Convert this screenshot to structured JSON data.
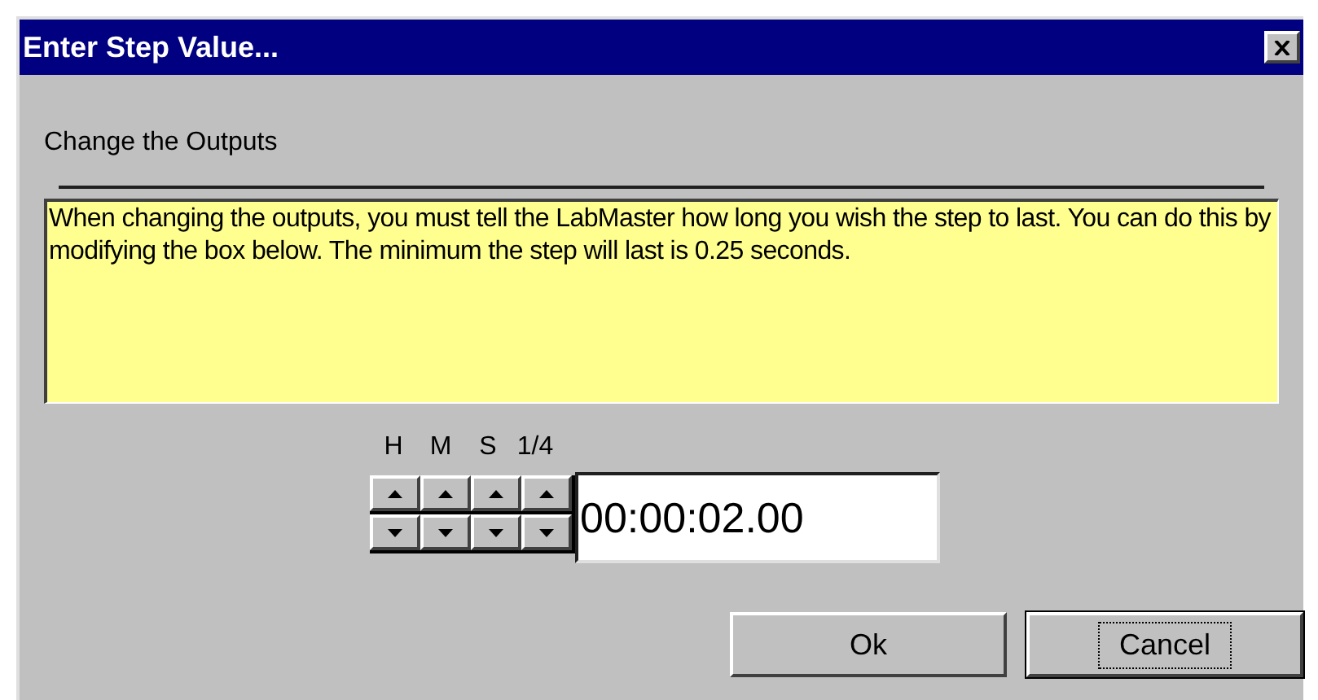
{
  "window": {
    "title": "Enter Step Value..."
  },
  "section_label": "Change the Outputs",
  "info_text": "When changing the outputs, you must tell the LabMaster how long you wish the step to last.  You can do this by modifying the box below.  The minimum the step will last is 0.25 seconds.",
  "spinner_units": [
    "H",
    "M",
    "S",
    "1/4"
  ],
  "time_field": {
    "value": "00:00:02.00"
  },
  "buttons": [
    {
      "label": "Ok",
      "focused": false
    },
    {
      "label": "Cancel",
      "focused": true
    }
  ]
}
